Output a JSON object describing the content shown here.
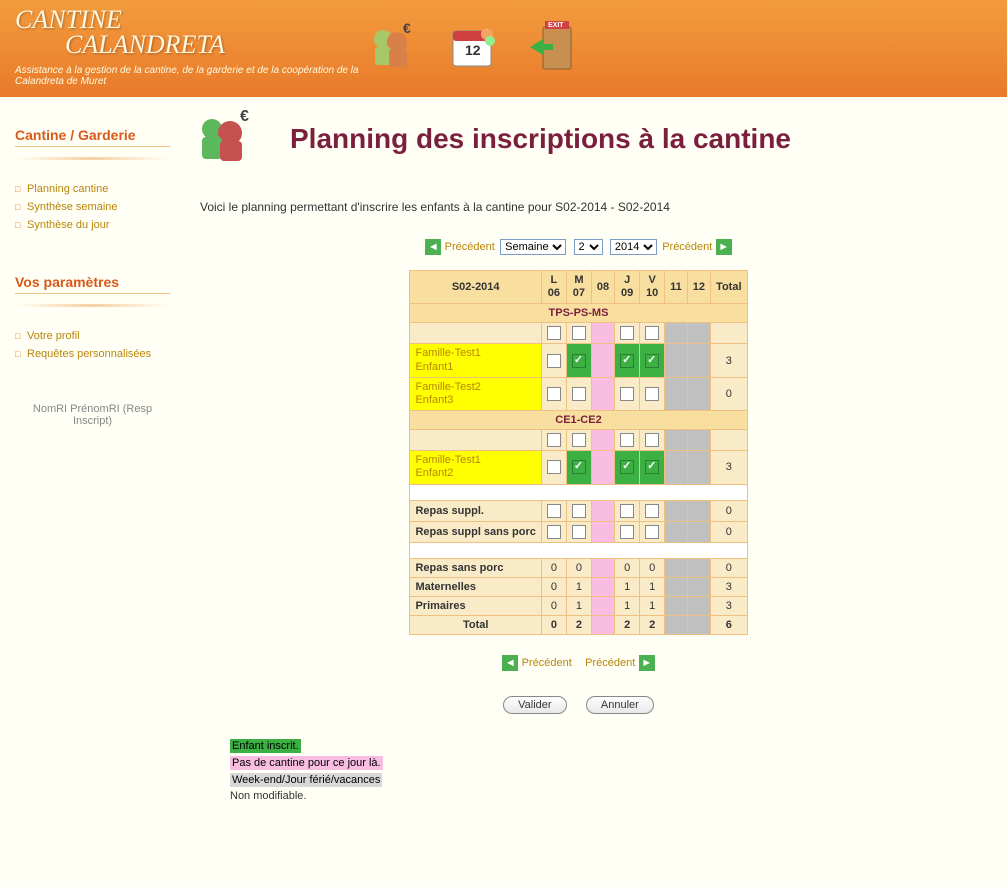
{
  "header": {
    "title1": "CANTINE",
    "title2": "CALANDRETA",
    "subtitle": "Assistance à la gestion de la cantine, de la garderie et de la coopération de la Calandreta de Muret"
  },
  "sidebar": {
    "section1_title": "Cantine / Garderie",
    "section1_items": [
      "Planning cantine",
      "Synthèse semaine",
      "Synthèse du jour"
    ],
    "section2_title": "Vos paramètres",
    "section2_items": [
      "Votre profil",
      "Requêtes personnalisées"
    ],
    "user": "NomRI PrénomRI (Resp Inscript)"
  },
  "page": {
    "title": "Planning des inscriptions à la cantine",
    "intro": "Voici le planning permettant d'inscrire les enfants à la cantine pour S02-2014 - S02-2014"
  },
  "nav": {
    "prev_label": "Précédent",
    "next_label": "Précédent",
    "period_select": "Semaine",
    "week_select": "2",
    "year_select": "2014"
  },
  "table": {
    "week_header": "S02-2014",
    "days": [
      {
        "d": "L",
        "n": "06"
      },
      {
        "d": "M",
        "n": "07"
      },
      {
        "d": "",
        "n": "08"
      },
      {
        "d": "J",
        "n": "09"
      },
      {
        "d": "V",
        "n": "10"
      },
      {
        "d": "",
        "n": "11"
      },
      {
        "d": "",
        "n": "12"
      }
    ],
    "total_label": "Total",
    "class1": "TPS-PS-MS",
    "class2": "CE1-CE2",
    "child1": {
      "fam": "Famille-Test1",
      "name": "Enfant1",
      "total": "3"
    },
    "child2": {
      "fam": "Famille-Test2",
      "name": "Enfant3",
      "total": "0"
    },
    "child3": {
      "fam": "Famille-Test1",
      "name": "Enfant2",
      "total": "3"
    },
    "stats": {
      "repas_suppl": "Repas suppl.",
      "repas_suppl_total": "0",
      "repas_suppl_sp": "Repas suppl sans porc",
      "repas_suppl_sp_total": "0",
      "repas_sp": "Repas sans porc",
      "repas_sp_vals": [
        "0",
        "0",
        "",
        "0",
        "0"
      ],
      "repas_sp_total": "0",
      "maternelles": "Maternelles",
      "maternelles_vals": [
        "0",
        "1",
        "",
        "1",
        "1"
      ],
      "maternelles_total": "3",
      "primaires": "Primaires",
      "primaires_vals": [
        "0",
        "1",
        "",
        "1",
        "1"
      ],
      "primaires_total": "3",
      "total_label": "Total",
      "total_vals": [
        "0",
        "2",
        "",
        "2",
        "2"
      ],
      "total_total": "6"
    }
  },
  "buttons": {
    "validate": "Valider",
    "cancel": "Annuler"
  },
  "legend": {
    "l1": "Enfant inscrit.",
    "l2": "Pas de cantine pour ce jour là.",
    "l3": "Week-end/Jour férié/vacances",
    "l4": "Non modifiable."
  }
}
